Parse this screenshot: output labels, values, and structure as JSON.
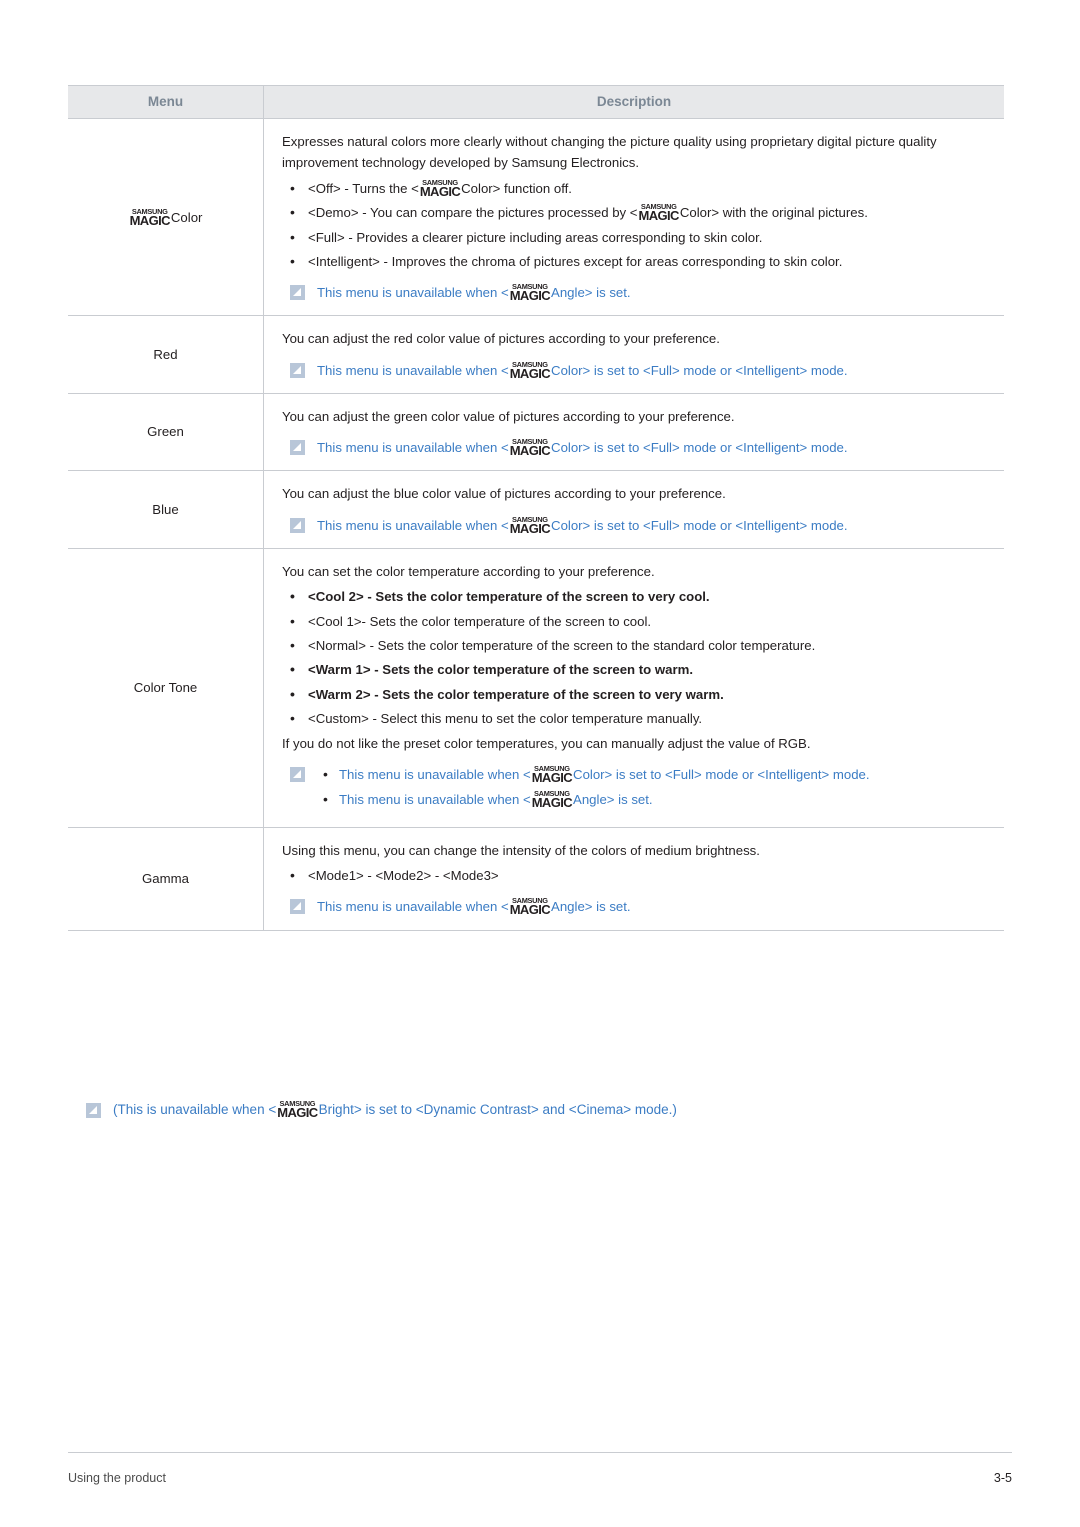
{
  "table": {
    "headers": {
      "menu": "Menu",
      "description": "Description"
    },
    "rows": [
      {
        "menu_prefix": "",
        "menu_has_logo": true,
        "menu_suffix": "Color",
        "desc_intro": "Expresses natural colors more clearly without changing the picture quality using proprietary digital picture quality improvement technology developed by Samsung Electronics.",
        "bullets": [
          {
            "pre": "<Off> - Turns the <",
            "logo": true,
            "post": "Color> function off."
          },
          {
            "pre": "<Demo> - You can compare the pictures processed by <",
            "logo": true,
            "post": "Color> with the original pictures."
          },
          {
            "pre": "<Full> - Provides a clearer picture including areas corresponding to skin color.",
            "logo": false,
            "post": ""
          },
          {
            "pre": "<Intelligent> - Improves the chroma of pictures except for areas corresponding to skin color.",
            "logo": false,
            "post": ""
          }
        ],
        "note": {
          "pre": "This menu is unavailable when <",
          "logo": true,
          "post": "Angle> is set."
        }
      },
      {
        "menu_prefix": "Red",
        "menu_has_logo": false,
        "menu_suffix": "",
        "desc_intro": "You can adjust the red color value of pictures according to your preference.",
        "bullets": [],
        "note": {
          "pre": "This menu is unavailable when <",
          "logo": true,
          "post": "Color> is set to <Full> mode or <Intelligent> mode."
        }
      },
      {
        "menu_prefix": "Green",
        "menu_has_logo": false,
        "menu_suffix": "",
        "desc_intro": "You can adjust the green color value of pictures according to your preference.",
        "bullets": [],
        "note": {
          "pre": "This menu is unavailable when <",
          "logo": true,
          "post": "Color> is set to <Full> mode or <Intelligent> mode."
        }
      },
      {
        "menu_prefix": "Blue",
        "menu_has_logo": false,
        "menu_suffix": "",
        "desc_intro": "You can adjust the blue color value of pictures according to your preference.",
        "bullets": [],
        "note": {
          "pre": "This menu is unavailable when <",
          "logo": true,
          "post": "Color> is set to <Full> mode or <Intelligent> mode."
        }
      },
      {
        "menu_prefix": "Color Tone",
        "menu_has_logo": false,
        "menu_suffix": "",
        "desc_intro": "You can set the color temperature according to your preference.",
        "bullets": [
          {
            "pre": "<Cool 2> - Sets the color temperature of the screen to very cool.",
            "logo": false,
            "post": "",
            "bold": true
          },
          {
            "pre": "<Cool 1>- Sets the color temperature of the screen to cool.",
            "logo": false,
            "post": ""
          },
          {
            "pre": "<Normal> - Sets the color temperature of the screen to the standard color temperature.",
            "logo": false,
            "post": ""
          },
          {
            "pre": "<Warm 1> - Sets the color temperature of the screen to warm.",
            "logo": false,
            "post": "",
            "bold": true
          },
          {
            "pre": "<Warm 2> - Sets the color temperature of the screen to very warm.",
            "logo": false,
            "post": "",
            "bold": true
          },
          {
            "pre": "<Custom> - Select this menu to set the color temperature manually.",
            "logo": false,
            "post": ""
          }
        ],
        "desc_outro": "If you do not like the preset color temperatures, you can manually adjust the value of RGB.",
        "notes_multi": [
          {
            "pre": "This menu is unavailable when <",
            "logo": true,
            "post": "Color> is set to <Full> mode or <Intelligent> mode."
          },
          {
            "pre": "This menu is unavailable when <",
            "logo": true,
            "post": "Angle> is set."
          }
        ]
      },
      {
        "menu_prefix": "Gamma",
        "menu_has_logo": false,
        "menu_suffix": "",
        "desc_intro": "Using this menu, you can change the intensity of the colors of medium brightness.",
        "bullets": [
          {
            "pre": "<Mode1> - <Mode2> - <Mode3>",
            "logo": false,
            "post": ""
          }
        ],
        "note": {
          "pre": "This menu is unavailable when <",
          "logo": true,
          "post": "Angle> is set."
        }
      }
    ]
  },
  "logo": {
    "top": "SAMSUNG",
    "bottom": "MAGIC"
  },
  "footer_note": {
    "pre": "(This is unavailable when <",
    "logo": true,
    "post": "Bright> is set to <Dynamic Contrast> and <Cinema> mode.)"
  },
  "footer": {
    "left": "Using the product",
    "right": "3-5"
  },
  "colors": {
    "note_blue": "#3b7cc4",
    "header_bg": "#e7e8ea",
    "header_text": "#7b8794",
    "border": "#c9ccd1",
    "body_text": "#231f20"
  }
}
